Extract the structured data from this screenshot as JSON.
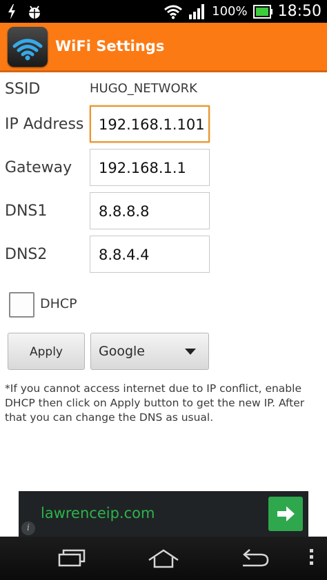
{
  "status_bar": {
    "battery_percent": "100%",
    "time": "18:50",
    "icons": [
      "usb-lightning-icon",
      "android-debug-icon",
      "wifi-signal-icon",
      "cell-signal-icon",
      "battery-icon"
    ]
  },
  "action_bar": {
    "title": "WiFi Settings",
    "icon": "wifi-app-icon",
    "color": "#fc7a14"
  },
  "form": {
    "ssid_label": "SSID",
    "ssid_value": "HUGO_NETWORK",
    "ip_label": "IP Address",
    "ip_value": "192.168.1.101",
    "gateway_label": "Gateway",
    "gateway_value": "192.168.1.1",
    "dns1_label": "DNS1",
    "dns1_value": "8.8.8.8",
    "dns2_label": "DNS2",
    "dns2_value": "8.8.4.4",
    "dhcp_label": "DHCP",
    "dhcp_checked": false,
    "apply_label": "Apply",
    "dns_provider_selected": "Google"
  },
  "note": "*If you cannot access internet due to IP conflict, enable DHCP then click on Apply button to get the new IP. After that you can change the DNS as usual.",
  "ad": {
    "text": "lawrenceip.com",
    "info_glyph": "i",
    "accent": "#2fa84d"
  },
  "nav_bar": {
    "buttons": [
      "recent-apps-icon",
      "home-icon",
      "back-icon",
      "overflow-menu-icon"
    ]
  }
}
